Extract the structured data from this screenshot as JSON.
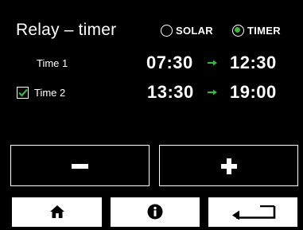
{
  "header": {
    "title": "Relay – timer",
    "modes": [
      {
        "label": "SOLAR",
        "selected": false
      },
      {
        "label": "TIMER",
        "selected": true
      }
    ]
  },
  "timers": [
    {
      "label": "Time 1",
      "checked": false,
      "start": "07:30",
      "end": "12:30"
    },
    {
      "label": "Time 2",
      "checked": true,
      "start": "13:30",
      "end": "19:00"
    }
  ],
  "icons": {
    "arrow": "arrow-right-icon",
    "checkbox_check": "checkmark-icon",
    "minus": "minus-icon",
    "plus": "plus-icon",
    "home": "home-icon",
    "info": "info-icon",
    "back": "return-arrow-icon"
  },
  "colors": {
    "background": "#000000",
    "foreground": "#ffffff",
    "accent_green": "#39b54a"
  }
}
